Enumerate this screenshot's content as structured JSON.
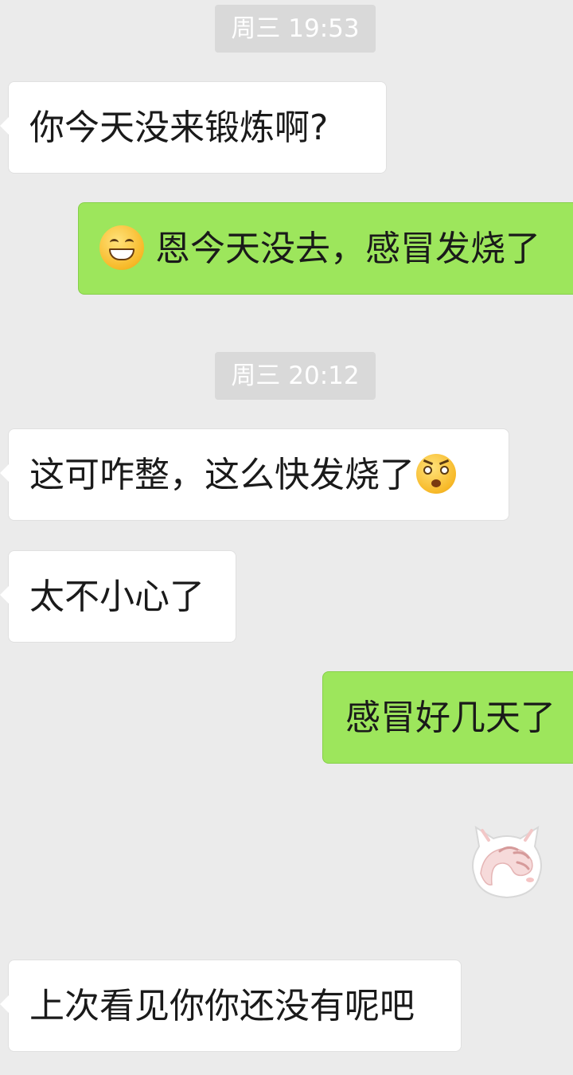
{
  "timestamps": [
    "周三 19:53",
    "周三 20:12"
  ],
  "messages": [
    {
      "side": "left",
      "text": "你今天没来锻炼啊?"
    },
    {
      "side": "right",
      "emoji": "grinning-face-emoji",
      "text": "恩今天没去，感冒发烧了"
    },
    {
      "side": "left",
      "text": "这可咋整，这么快发烧了",
      "emoji": "shocked-face-emoji"
    },
    {
      "side": "left",
      "text": "太不小心了"
    },
    {
      "side": "right",
      "text": "感冒好几天了"
    },
    {
      "side": "right",
      "sticker": "cat-covering-face-sticker"
    },
    {
      "side": "left",
      "text": "上次看见你你还没有呢吧"
    }
  ],
  "colors": {
    "background": "#ebebeb",
    "incoming_bubble": "#ffffff",
    "outgoing_bubble": "#9de65c",
    "timestamp_pill": "#d9d9d9"
  }
}
